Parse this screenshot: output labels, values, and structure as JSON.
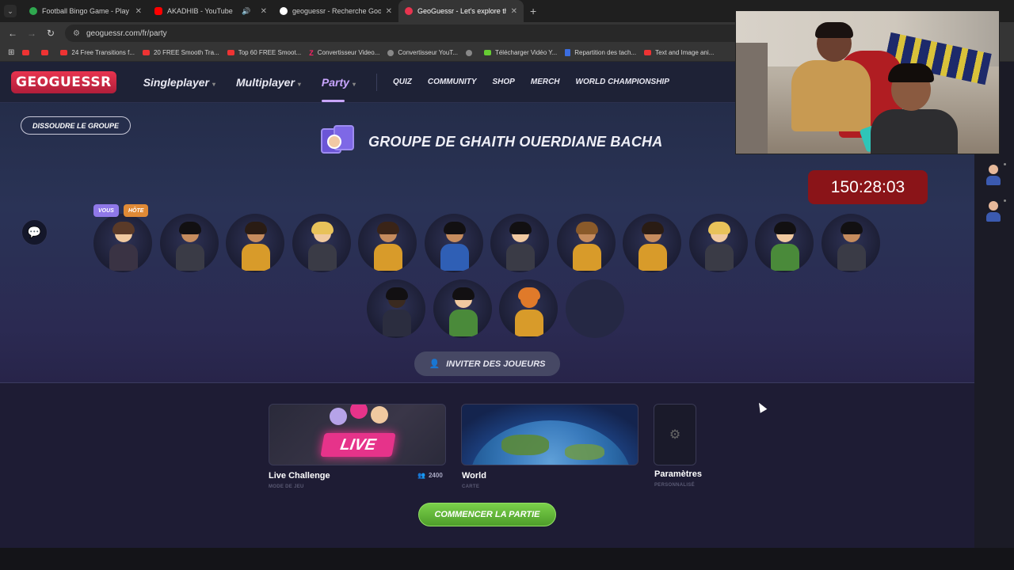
{
  "browser": {
    "tabs": [
      {
        "title": "Football Bingo Game - Play Now",
        "active": false,
        "favicon_color": "#2fa84f"
      },
      {
        "title": "AKADHIB - YouTube",
        "active": false,
        "favicon_color": "#ff0000"
      },
      {
        "title": "geoguessr - Recherche Google",
        "active": false,
        "favicon_color": "#ffffff"
      },
      {
        "title": "GeoGuessr - Let's explore the world",
        "active": true,
        "favicon_color": "#e8344f"
      }
    ],
    "url": "geoguessr.com/fr/party",
    "bookmarks": [
      {
        "label": "",
        "icon": "youtube-icon"
      },
      {
        "label": "",
        "icon": "youtube-icon"
      },
      {
        "label": "24 Free Transitions f...",
        "icon": "youtube-icon"
      },
      {
        "label": "20 FREE Smooth Tra...",
        "icon": "youtube-icon"
      },
      {
        "label": "Top 60 FREE Smoot...",
        "icon": "youtube-icon"
      },
      {
        "label": "Convertisseur Video...",
        "icon": "z-icon"
      },
      {
        "label": "Convertisseur YouT...",
        "icon": "convert-icon"
      },
      {
        "label": "",
        "icon": "globe-icon"
      },
      {
        "label": "Télécharger Vidéo Y...",
        "icon": "download-icon"
      },
      {
        "label": "Repartition des tach...",
        "icon": "doc-icon"
      },
      {
        "label": "Text and Image ani...",
        "icon": "youtube-icon"
      }
    ]
  },
  "site": {
    "logo": "GEOGUESSR",
    "main_nav": [
      "Singleplayer",
      "Multiplayer",
      "Party"
    ],
    "active_nav": "Party",
    "sub_nav": [
      "QUIZ",
      "COMMUNITY",
      "SHOP",
      "MERCH",
      "WORLD CHAMPIONSHIP"
    ]
  },
  "party": {
    "dissolve_label": "DISSOUDRE LE GROUPE",
    "group_title": "GROUPE DE GHAITH OUERDIANE BACHA",
    "timer": "150:28:03",
    "tags": {
      "you": "VOUS",
      "host": "HÔTE"
    },
    "invite_label": "INVITER DES JOUEURS",
    "players_row1_count": 12,
    "players_row2_count": 4
  },
  "game_settings": {
    "mode": {
      "label": "Live Challenge",
      "sub": "MODE DE JEU",
      "badge": "LIVE",
      "count": "2400"
    },
    "map": {
      "label": "World",
      "sub": "CARTE"
    },
    "settings": {
      "label": "Paramètres",
      "sub": "PERSONNALISÉ"
    },
    "start_label": "COMMENCER LA PARTIE"
  },
  "colors": {
    "brand": "#e8344f",
    "active_nav": "#c9a6ff",
    "timer_bg": "#8a1418",
    "start_btn": "#6cc23e",
    "live_badge": "#e6338a"
  }
}
